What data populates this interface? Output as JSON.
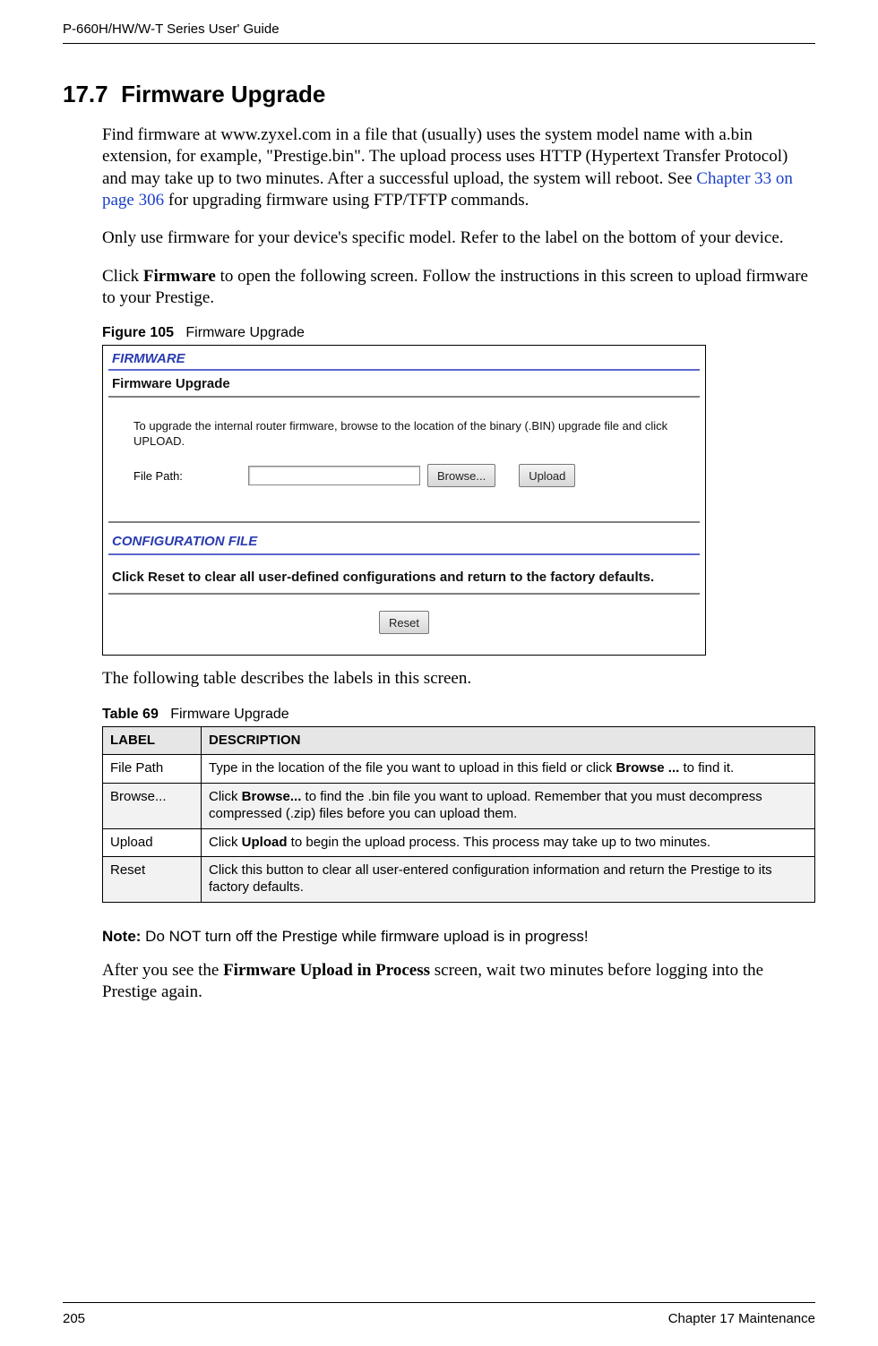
{
  "header": {
    "guide_title": "P-660H/HW/W-T Series User' Guide"
  },
  "footer": {
    "page_number": "205",
    "chapter": "Chapter 17 Maintenance"
  },
  "section": {
    "number": "17.7",
    "title": "Firmware Upgrade"
  },
  "paragraphs": {
    "p1a": "Find firmware at www.zyxel.com in a file that (usually) uses the system model name with a.bin extension, for example, \"Prestige.bin\". The upload process uses HTTP (Hypertext Transfer Protocol) and may take up to two minutes. After a successful upload, the system will reboot. See ",
    "p1_xref": "Chapter 33 on page 306",
    "p1b": " for upgrading firmware using FTP/TFTP commands.",
    "p2": "Only use firmware for your device's specific model. Refer to the label on the bottom of your device.",
    "p3a": "Click ",
    "p3_bold": "Firmware",
    "p3b": " to open the following screen. Follow the instructions in this screen to upload firmware to your Prestige.",
    "after_figure": "The following table describes the labels in this screen.",
    "after_table_a": "After you see the ",
    "after_table_bold": "Firmware Upload in Process",
    "after_table_b": " screen, wait two minutes before logging into the Prestige again."
  },
  "figure": {
    "label": "Figure 105",
    "caption": "Firmware Upgrade",
    "panel": {
      "section1_title": "FIRMWARE",
      "subtitle": "Firmware Upgrade",
      "instruction": "To upgrade the internal router firmware, browse to the location of the binary (.BIN) upgrade file and click UPLOAD.",
      "file_path_label": "File Path:",
      "browse_btn": "Browse...",
      "upload_btn": "Upload",
      "section2_title": "CONFIGURATION FILE",
      "reset_msg": "Click Reset to clear all user-defined configurations and return to the factory defaults.",
      "reset_btn": "Reset"
    }
  },
  "table": {
    "label": "Table 69",
    "caption": "Firmware Upgrade",
    "headers": {
      "col1": "LABEL",
      "col2": "DESCRIPTION"
    },
    "rows": [
      {
        "label": "File Path",
        "desc_a": "Type in the location of the file you want to upload in this field or click ",
        "desc_bold": "Browse ...",
        "desc_b": " to find it."
      },
      {
        "label": "Browse...",
        "desc_a": "Click ",
        "desc_bold": "Browse...",
        "desc_b": " to find the .bin file you want to upload. Remember that you must decompress compressed (.zip) files before you can upload them."
      },
      {
        "label": "Upload",
        "desc_a": "Click ",
        "desc_bold": "Upload",
        "desc_b": " to begin the upload process. This process may take up to two minutes."
      },
      {
        "label": "Reset",
        "desc_a": "Click this button to clear all user-entered configuration information and return the Prestige to its factory defaults.",
        "desc_bold": "",
        "desc_b": ""
      }
    ]
  },
  "note": {
    "prefix": "Note: ",
    "text": "Do NOT turn off the Prestige while firmware upload is in progress!"
  }
}
